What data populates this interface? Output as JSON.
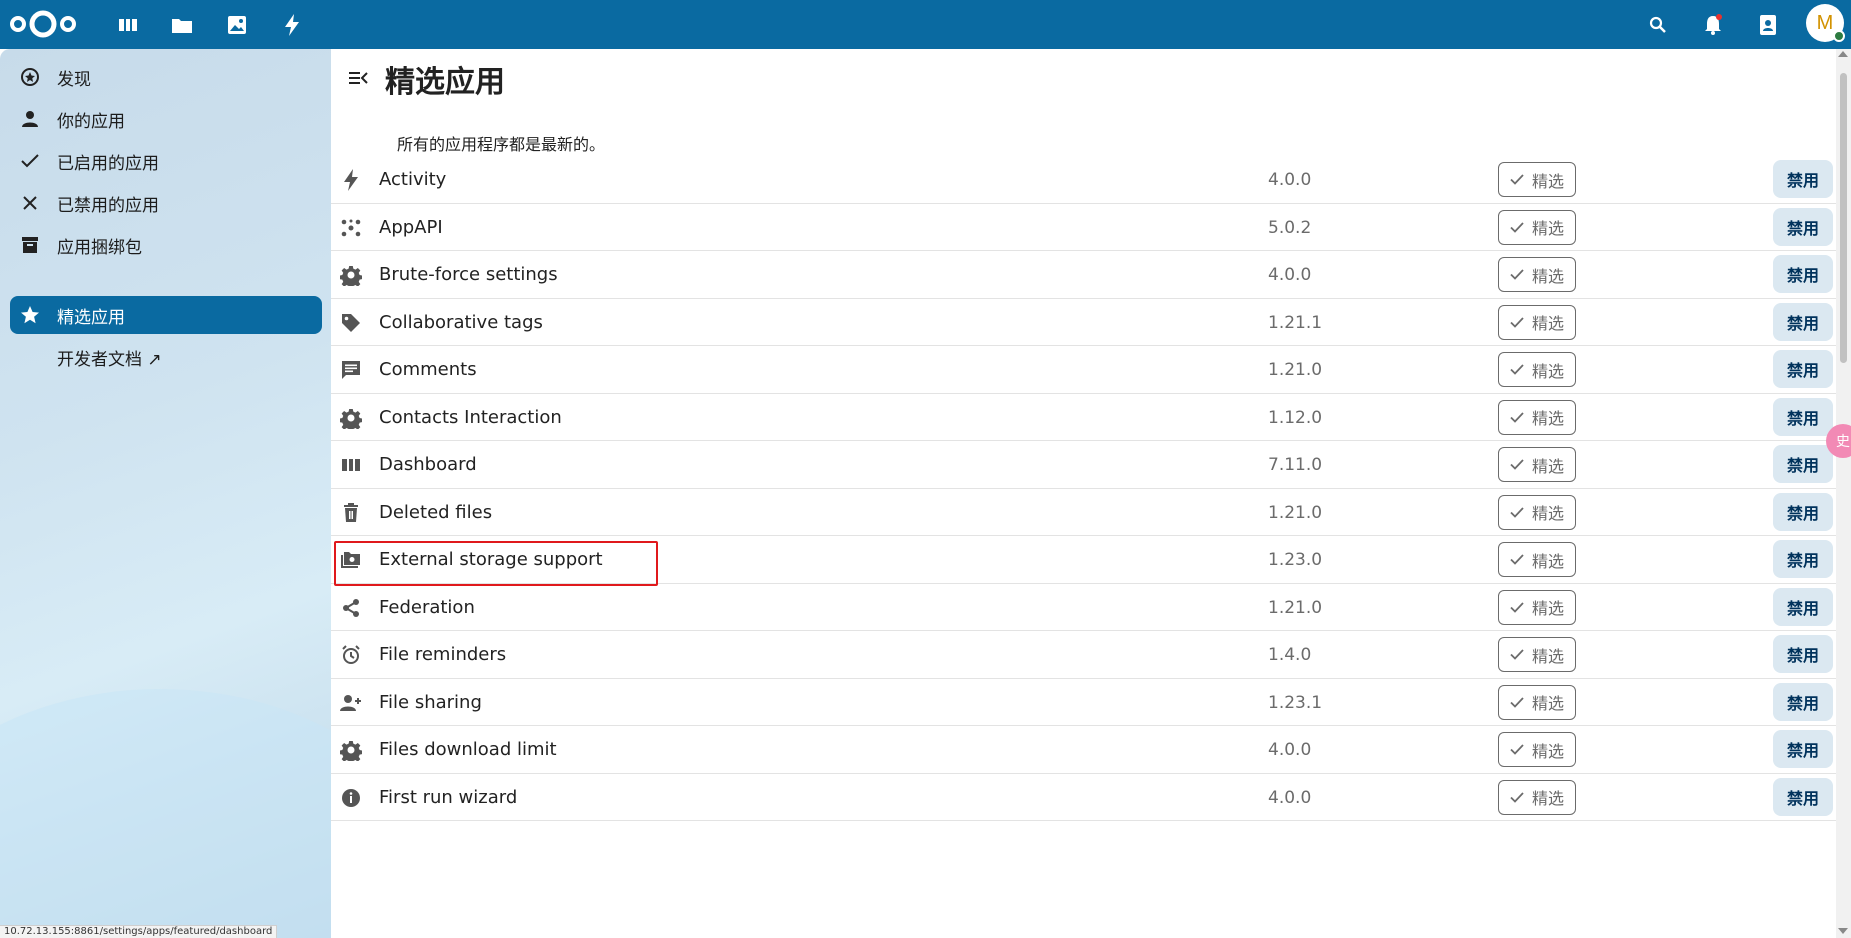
{
  "header": {
    "apps": [
      {
        "icon": "dashboard-icon"
      },
      {
        "icon": "files-icon"
      },
      {
        "icon": "photos-icon"
      },
      {
        "icon": "activity-icon"
      }
    ],
    "right_icons": [
      "search-icon",
      "notifications-icon",
      "contacts-icon"
    ],
    "avatar_letter": "M",
    "accent_color": "#0a6aa1"
  },
  "sidebar": {
    "items": [
      {
        "label": "发现",
        "icon": "discover-icon"
      },
      {
        "label": "你的应用",
        "icon": "user-icon"
      },
      {
        "label": "已启用的应用",
        "icon": "check-icon"
      },
      {
        "label": "已禁用的应用",
        "icon": "close-icon"
      },
      {
        "label": "应用捆绑包",
        "icon": "archive-icon"
      },
      {
        "label": "精选应用",
        "icon": "star-icon",
        "active": true
      },
      {
        "label": "开发者文档 ↗",
        "icon": ""
      }
    ]
  },
  "main": {
    "title": "精选应用",
    "update_message": "所有的应用程序都是最新的。",
    "featured_label": "精选",
    "disable_label": "禁用",
    "apps": [
      {
        "name": "Activity",
        "version": "4.0.0",
        "icon": "lightning-icon"
      },
      {
        "name": "AppAPI",
        "version": "5.0.2",
        "icon": "appapi-icon"
      },
      {
        "name": "Brute-force settings",
        "version": "4.0.0",
        "icon": "gear-icon"
      },
      {
        "name": "Collaborative tags",
        "version": "1.21.1",
        "icon": "tag-icon"
      },
      {
        "name": "Comments",
        "version": "1.21.0",
        "icon": "comment-icon"
      },
      {
        "name": "Contacts Interaction",
        "version": "1.12.0",
        "icon": "gear-icon"
      },
      {
        "name": "Dashboard",
        "version": "7.11.0",
        "icon": "dashboard-icon"
      },
      {
        "name": "Deleted files",
        "version": "1.21.0",
        "icon": "trash-icon"
      },
      {
        "name": "External storage support",
        "version": "1.23.0",
        "icon": "external-storage-icon",
        "highlighted": true
      },
      {
        "name": "Federation",
        "version": "1.21.0",
        "icon": "share-icon"
      },
      {
        "name": "File reminders",
        "version": "1.4.0",
        "icon": "alarm-icon"
      },
      {
        "name": "File sharing",
        "version": "1.23.1",
        "icon": "user-plus-icon"
      },
      {
        "name": "Files download limit",
        "version": "4.0.0",
        "icon": "gear-icon"
      },
      {
        "name": "First run wizard",
        "version": "4.0.0",
        "icon": "info-icon"
      }
    ]
  },
  "floating_widget_text": "史",
  "status_url": "10.72.13.155:8861/settings/apps/featured/dashboard"
}
